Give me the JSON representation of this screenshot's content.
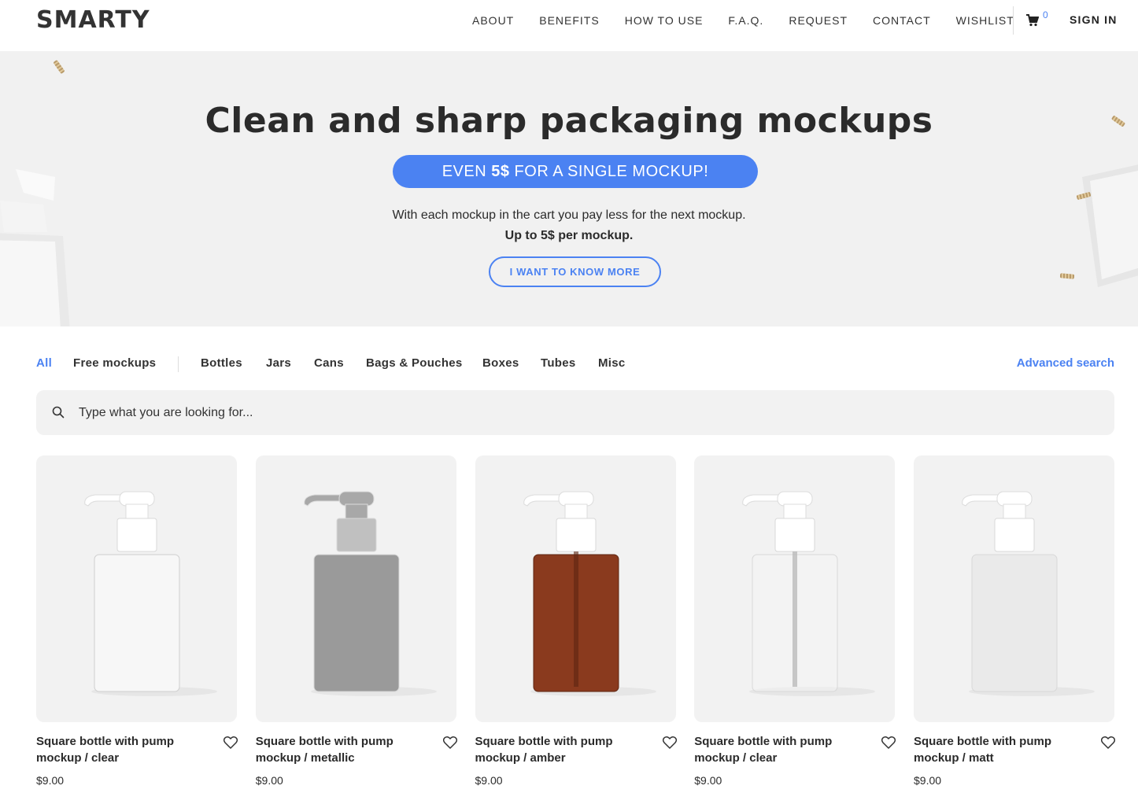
{
  "header": {
    "logo": "SMARTY",
    "nav": [
      "ABOUT",
      "BENEFITS",
      "HOW TO USE",
      "F.A.Q.",
      "REQUEST",
      "CONTACT",
      "WISHLIST"
    ],
    "cart_icon": "cart-icon",
    "cart_count": "0",
    "signin": "SIGN IN"
  },
  "hero": {
    "title": "Clean and sharp packaging mockups",
    "promo_prefix": "EVEN ",
    "promo_bold": "5$",
    "promo_suffix": " FOR A SINGLE MOCKUP!",
    "text_line1": "With each mockup in the cart you pay less for the next mockup.",
    "text_line2": "Up to 5$ per mockup.",
    "cta": "I WANT TO KNOW MORE"
  },
  "filters": {
    "items": [
      "All",
      "Free mockups",
      "Bottles",
      "Jars",
      "Cans",
      "Bags & Pouches",
      "Boxes",
      "Tubes",
      "Misc"
    ],
    "active": "All",
    "advanced": "Advanced search"
  },
  "search": {
    "placeholder": "Type what you are looking for...",
    "icon": "search-icon"
  },
  "colors": {
    "accent": "#4b82f2",
    "card_bg": "#f2f2f2",
    "hero_bg": "#f1f1f1"
  },
  "products": [
    {
      "title_line1": "Square bottle with pump",
      "title_line2": "mockup / clear",
      "price": "$9.00",
      "variant": "white",
      "body": "#f7f7f7",
      "cap": "#ffffff"
    },
    {
      "title_line1": "Square bottle with pump",
      "title_line2": "mockup / metallic",
      "price": "$9.00",
      "variant": "metallic",
      "body": "#9a9a9a",
      "cap": "#a8a8a8"
    },
    {
      "title_line1": "Square bottle with pump",
      "title_line2": "mockup / amber",
      "price": "$9.00",
      "variant": "amber",
      "body": "#8a3a1e",
      "cap": "#ffffff"
    },
    {
      "title_line1": "Square bottle with pump",
      "title_line2": "mockup / clear",
      "price": "$9.00",
      "variant": "clear",
      "body": "#f4f4f4",
      "cap": "#ffffff"
    },
    {
      "title_line1": "Square bottle with pump",
      "title_line2": "mockup / matt",
      "price": "$9.00",
      "variant": "matt",
      "body": "#eaeaea",
      "cap": "#ffffff"
    }
  ]
}
